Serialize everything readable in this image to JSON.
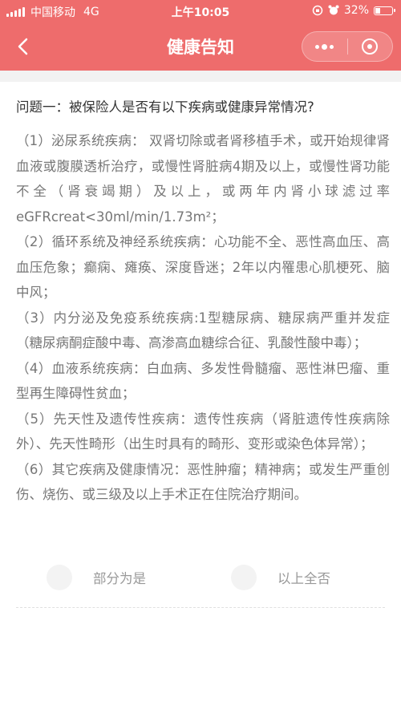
{
  "status_bar": {
    "carrier": "中国移动",
    "network": "4G",
    "time": "上午10:05",
    "battery_percent": "32%",
    "battery_level": 0.32
  },
  "nav": {
    "title": "健康告知",
    "back_icon": "chevron-left-icon",
    "more_icon": "more-dots-icon",
    "close_icon": "target-circle-icon"
  },
  "question": {
    "title": "问题一：被保险人是否有以下疾病或健康异常情况?",
    "items": [
      "（1）泌尿系统疾病： 双肾切除或者肾移植手术，或开始规律肾血液或腹膜透析治疗，或慢性肾脏病4期及以上，或慢性肾功能不全（肾衰竭期）及以上，或两年内肾小球滤过率 eGFRcreat<30ml/min/1.73m²；",
      "（2）循环系统及神经系统疾病：心功能不全、恶性高血压、高血压危象；癫痫、瘫痪、深度昏迷；2年以内罹患心肌梗死、脑中风；",
      "（3）内分泌及免疫系统疾病:1型糖尿病、糖尿病严重并发症（糖尿病酮症酸中毒、高渗高血糖综合征、乳酸性酸中毒）；",
      "（4）血液系统疾病：白血病、多发性骨髓瘤、恶性淋巴瘤、重型再生障碍性贫血；",
      "（5）先天性及遗传性疾病：遗传性疾病（肾脏遗传性疾病除外）、先天性畸形（出生时具有的畸形、变形或染色体异常）；",
      "（6）其它疾病及健康情况：恶性肿瘤；精神病；或发生严重创伤、烧伤、或三级及以上手术正在住院治疗期间。"
    ]
  },
  "answers": {
    "partial_yes": "部分为是",
    "all_no": "以上全否"
  },
  "colors": {
    "header_bg": "#ee6c6c",
    "body_text": "#777777",
    "title_text": "#333333"
  }
}
